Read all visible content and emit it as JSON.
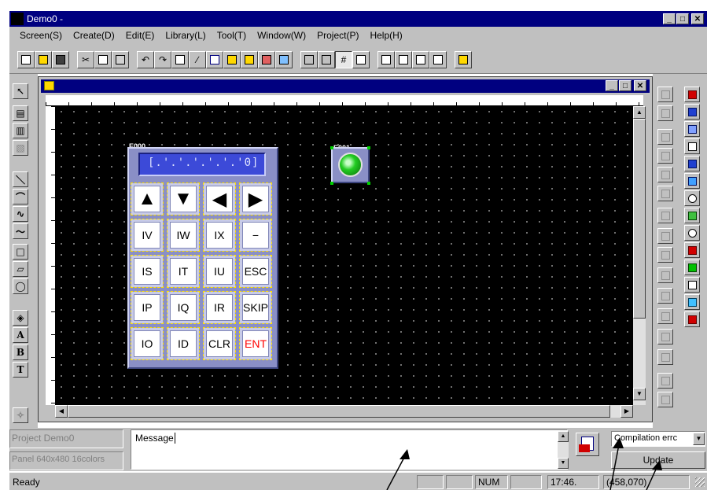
{
  "window": {
    "title": "Demo0  -"
  },
  "menu": [
    "Screen(S)",
    "Create(D)",
    "Edit(E)",
    "Library(L)",
    "Tool(T)",
    "Window(W)",
    "Project(P)",
    "Help(H)"
  ],
  "keypad": {
    "tag": "E000",
    "display": "[.'.'.'.'.'.'0]",
    "keys": [
      [
        "▲",
        "▼",
        "◀",
        "▶"
      ],
      [
        "IV",
        "IW",
        "IX",
        "−"
      ],
      [
        "IS",
        "IT",
        "IU",
        "ESC"
      ],
      [
        "IP",
        "IQ",
        "IR",
        "SKIP"
      ],
      [
        "IO",
        "ID",
        "CLR",
        "ENT"
      ]
    ]
  },
  "lamp": {
    "tag": "E001"
  },
  "info": {
    "project": "Project Demo0",
    "panel": "Panel 640x480 16colors"
  },
  "message": {
    "label": "Message"
  },
  "compile": {
    "select_value": "Compilation errc",
    "update_label": "Update"
  },
  "status": {
    "ready": "Ready",
    "num": "NUM",
    "time": "17:46.",
    "coord": "(458,070)"
  },
  "colors": {
    "titlebar": "#000080",
    "canvas": "#000000",
    "key_enter_text": "#ff0000",
    "lamp": "#22cc22"
  }
}
